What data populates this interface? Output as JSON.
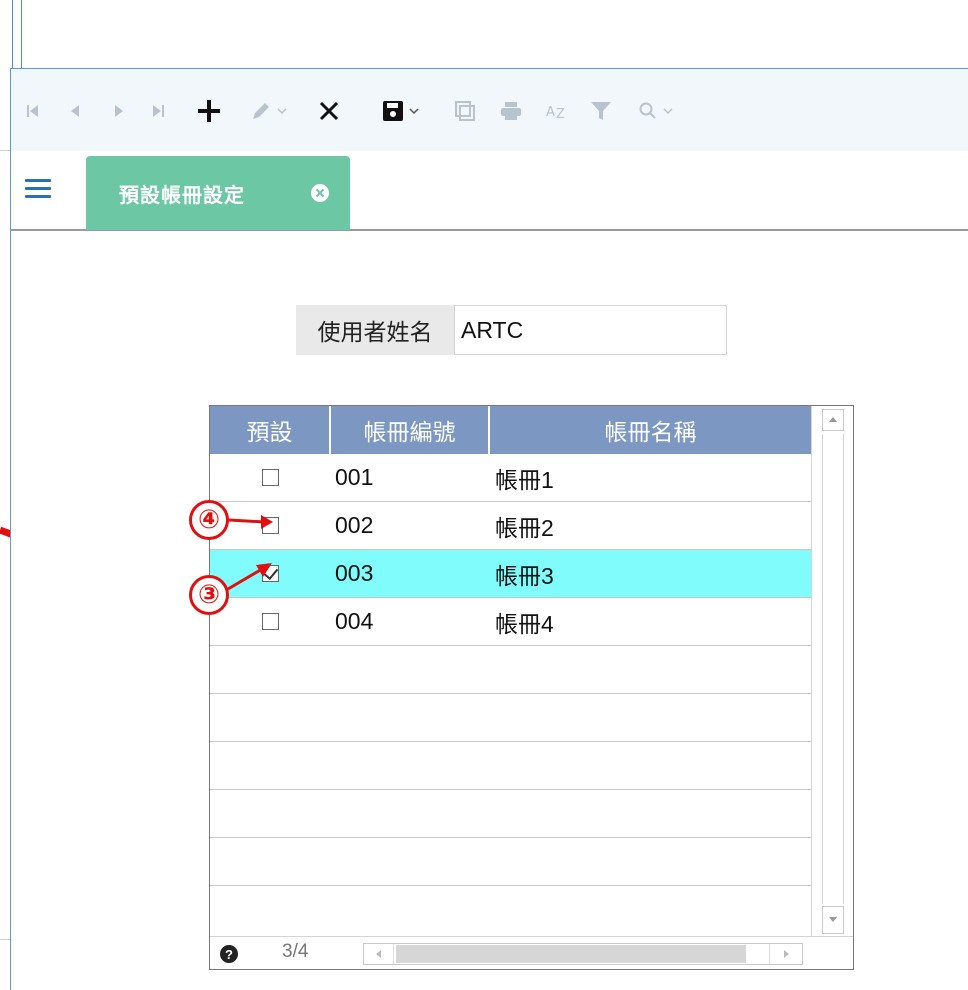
{
  "toolbar": {
    "buttons": [
      {
        "name": "first-record-icon",
        "enabled": false
      },
      {
        "name": "prev-record-icon",
        "enabled": false
      },
      {
        "name": "next-record-icon",
        "enabled": false
      },
      {
        "name": "last-record-icon",
        "enabled": false
      },
      {
        "name": "add-icon",
        "enabled": true
      },
      {
        "name": "edit-icon",
        "enabled": false
      },
      {
        "name": "delete-icon",
        "enabled": true
      },
      {
        "name": "save-icon",
        "enabled": true
      },
      {
        "name": "copy-icon",
        "enabled": false
      },
      {
        "name": "print-icon",
        "enabled": false
      },
      {
        "name": "sort-az-icon",
        "enabled": false
      },
      {
        "name": "filter-icon",
        "enabled": false
      },
      {
        "name": "search-icon",
        "enabled": false
      }
    ]
  },
  "tab": {
    "label": "預設帳冊設定"
  },
  "form": {
    "user_label": "使用者姓名",
    "user_value": "ARTC"
  },
  "grid": {
    "columns": [
      "預設",
      "帳冊編號",
      "帳冊名稱"
    ],
    "rows": [
      {
        "default": false,
        "code": "001",
        "name": "帳冊1",
        "selected": false
      },
      {
        "default": false,
        "code": "002",
        "name": "帳冊2",
        "selected": false
      },
      {
        "default": true,
        "code": "003",
        "name": "帳冊3",
        "selected": true
      },
      {
        "default": false,
        "code": "004",
        "name": "帳冊4",
        "selected": false
      }
    ],
    "pager": "3/4",
    "help_glyph": "?"
  },
  "annotations": {
    "callout_4": "④",
    "callout_3": "③"
  },
  "colors": {
    "accent": "#6cc7a4",
    "header": "#7b97c2",
    "selected_row": "#80fcfc",
    "annotation": "#e01010"
  }
}
